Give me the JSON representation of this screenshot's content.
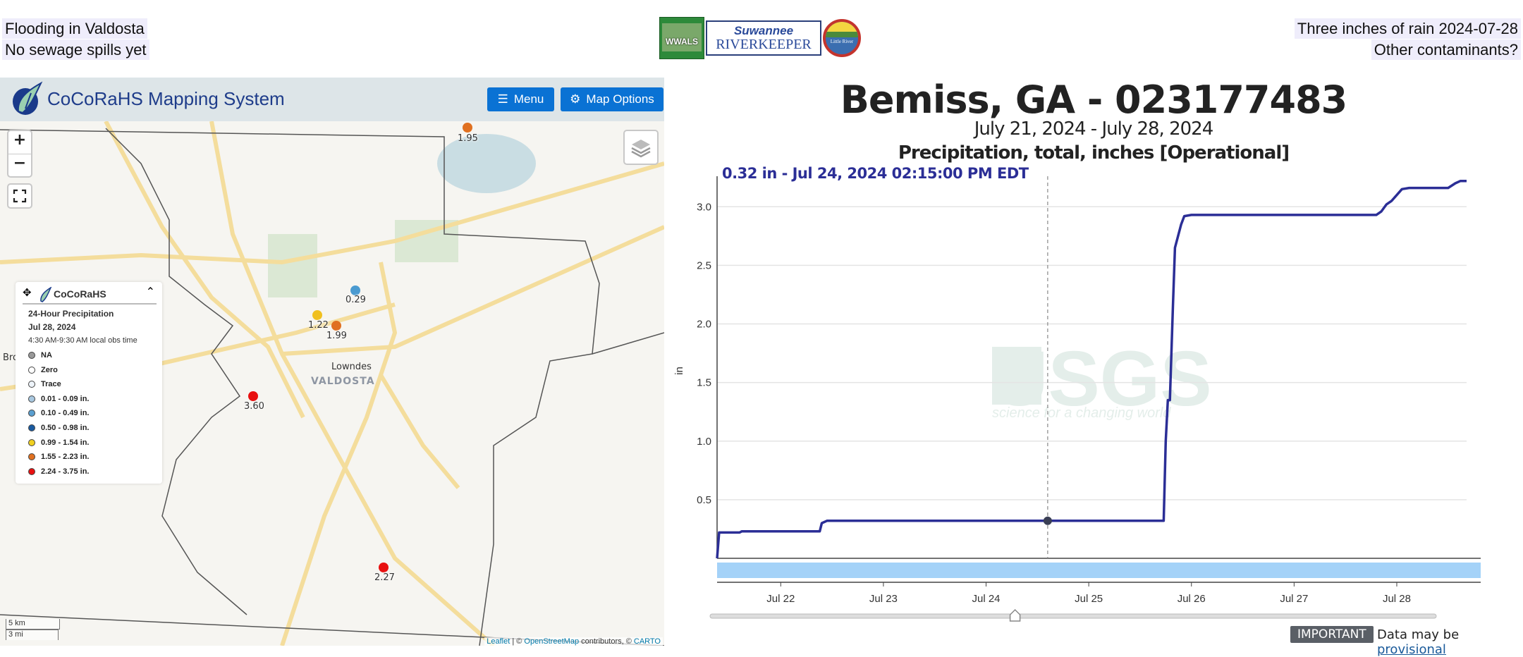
{
  "captions": {
    "left": [
      "Flooding in Valdosta",
      "No sewage spills yet"
    ],
    "right": [
      "Three inches of rain 2024-07-28",
      "Other contaminants?"
    ]
  },
  "logos": {
    "wwals": "WWALS",
    "riverkeeper_line1": "Suwannee",
    "riverkeeper_line2": "RIVERKEEPER",
    "littleriver": "Little River"
  },
  "map": {
    "app_title": "CoCoRaHS Mapping System",
    "menu_label": "Menu",
    "options_label": "Map Options",
    "zoom_in": "+",
    "zoom_out": "−",
    "places": {
      "lowndes": "Lowndes",
      "valdosta": "VALDOSTA",
      "bro": "Bro"
    },
    "markers": [
      {
        "value": "1.95",
        "color": "#e07020"
      },
      {
        "value": "0.29",
        "color": "#4a9ad0"
      },
      {
        "value": "1.22",
        "color": "#f0c020"
      },
      {
        "value": "1.99",
        "color": "#e07020"
      },
      {
        "value": "3.60",
        "color": "#e81010"
      },
      {
        "value": "2.27",
        "color": "#e81010"
      }
    ],
    "legend": {
      "title": "CoCoRaHS",
      "line1": "24-Hour Precipitation",
      "line2": "Jul 28, 2024",
      "line3": "4:30 AM-9:30 AM local obs time",
      "items": [
        {
          "label": "NA",
          "color": "#999999"
        },
        {
          "label": "Zero",
          "color": "#ffffff"
        },
        {
          "label": "Trace",
          "color": "#eef4fa"
        },
        {
          "label": "0.01 - 0.09 in.",
          "color": "#a9c8e0"
        },
        {
          "label": "0.10 - 0.49 in.",
          "color": "#5a9fd0"
        },
        {
          "label": "0.50 - 0.98 in.",
          "color": "#1a5aa0"
        },
        {
          "label": "0.99 - 1.54 in.",
          "color": "#f0d020"
        },
        {
          "label": "1.55 - 2.23 in.",
          "color": "#e07020"
        },
        {
          "label": "2.24 - 3.75 in.",
          "color": "#e81010"
        }
      ]
    },
    "scale_km": "5 km",
    "scale_mi": "3 mi",
    "attribution": {
      "leaflet": "Leaflet",
      "sep": " | © ",
      "osm": "OpenStreetMap",
      "mid": " contributors, © ",
      "carto": "CARTO"
    }
  },
  "chart": {
    "title": "Bemiss, GA - 023177483",
    "dates": "July 21, 2024 - July 28, 2024",
    "parameter": "Precipitation, total, inches [Operational]",
    "tooltip": "0.32 in - Jul 24, 2024 02:15:00 PM EDT",
    "watermark": "USGS",
    "watermark_sub": "science for a changing world",
    "important_label": "IMPORTANT",
    "provisional_prefix": "Data may be ",
    "provisional_link": "provisional"
  },
  "chart_data": {
    "type": "line",
    "title": "Bemiss, GA - 023177483",
    "subtitle": "July 21, 2024 - July 28, 2024",
    "ylabel": "in",
    "xlabel": "",
    "ylim": [
      0,
      3.2
    ],
    "yticks": [
      0.5,
      1.0,
      1.5,
      2.0,
      2.5,
      3.0
    ],
    "ytick_labels": [
      "0.5",
      "1.0",
      "1.5",
      "2.0",
      "2.5",
      "3.0"
    ],
    "xlim_days": [
      21.38,
      28.68
    ],
    "xticks_days": [
      22,
      23,
      24,
      25,
      26,
      27,
      28
    ],
    "xtick_labels": [
      "Jul 22",
      "Jul 23",
      "Jul 24",
      "Jul 25",
      "Jul 26",
      "Jul 27",
      "Jul 28"
    ],
    "grid": true,
    "series": [
      {
        "name": "Precipitation, total, inches",
        "color": "#2b2e96",
        "x_days": [
          21.38,
          21.4,
          21.6,
          21.62,
          22.38,
          22.4,
          22.45,
          25.73,
          25.75,
          25.77,
          25.79,
          25.82,
          25.84,
          25.87,
          25.9,
          25.93,
          26.0,
          27.8,
          27.85,
          27.9,
          27.95,
          28.05,
          28.12,
          28.5,
          28.57,
          28.62,
          28.68
        ],
        "y": [
          0.0,
          0.22,
          0.22,
          0.23,
          0.23,
          0.3,
          0.32,
          0.32,
          1.0,
          1.35,
          1.35,
          2.15,
          2.65,
          2.75,
          2.85,
          2.92,
          2.93,
          2.93,
          2.96,
          3.02,
          3.05,
          3.15,
          3.16,
          3.16,
          3.2,
          3.22,
          3.22
        ]
      }
    ],
    "highlight": {
      "x_day": 24.6,
      "y": 0.32,
      "label": "0.32 in - Jul 24, 2024 02:15:00 PM EDT"
    },
    "slider_position": 0.42
  }
}
